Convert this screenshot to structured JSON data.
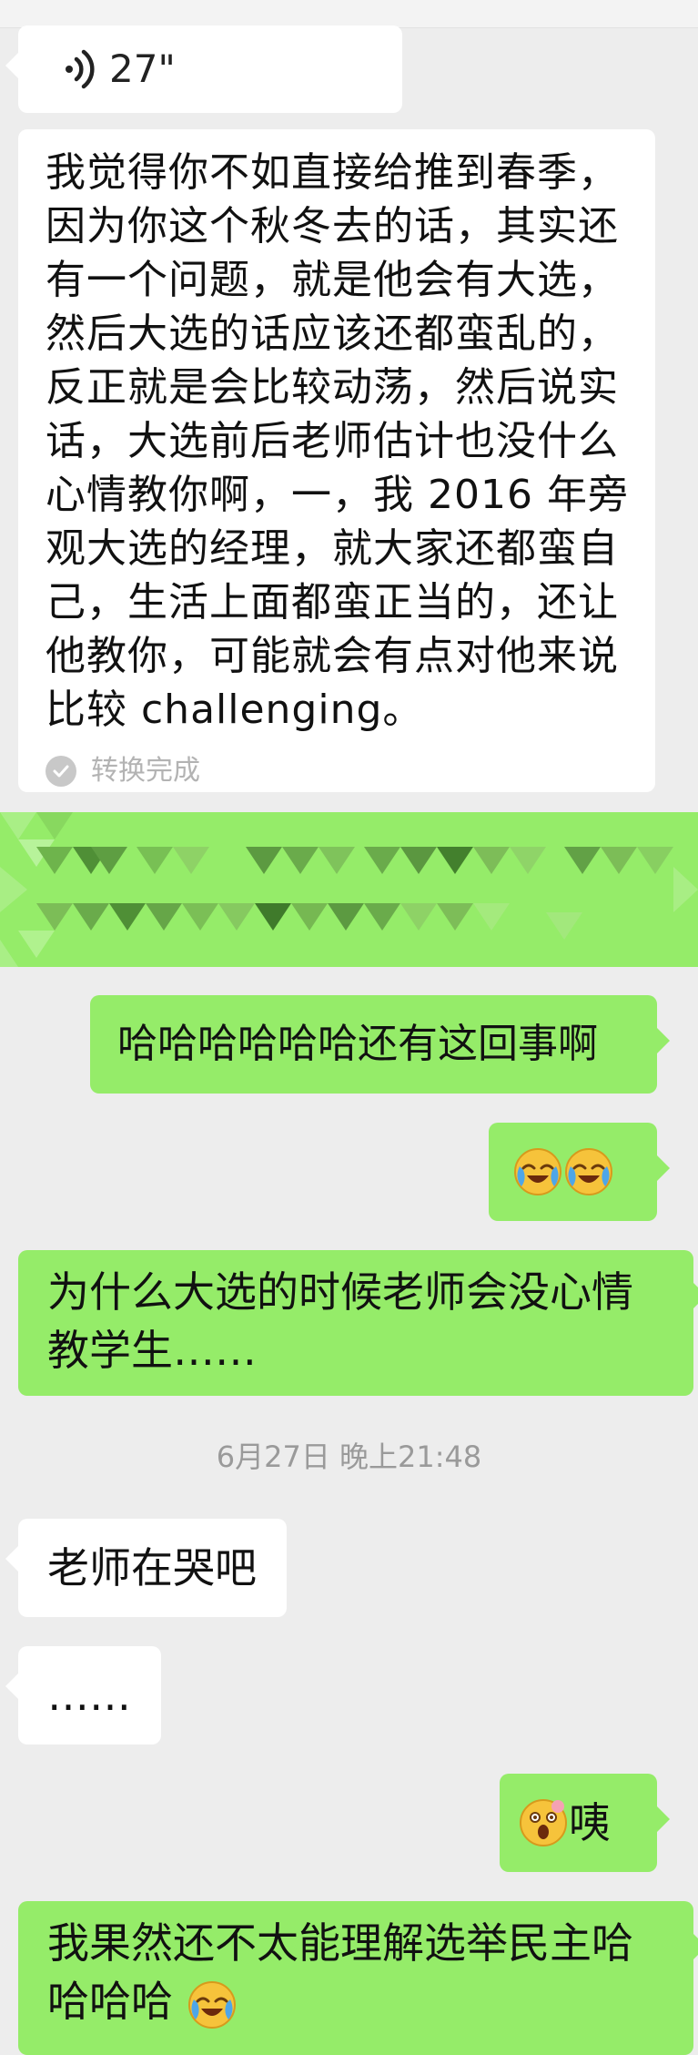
{
  "voice": {
    "duration": "27\""
  },
  "transcript": {
    "text": "我觉得你不如直接给推到春季，因为你这个秋冬去的话，其实还有一个问题，就是他会有大选，然后大选的话应该还都蛮乱的，反正就是会比较动荡，然后说实话，大选前后老师估计也没什么心情教你啊，一，我 2016 年旁观大选的经理，就大家还都蛮自己，生活上面都蛮正当的，还让他教你，可能就会有点对他来说比较 challenging。",
    "status": "转换完成"
  },
  "messages": {
    "m1": "哈哈哈哈哈哈还有这回事啊",
    "m3": "为什么大选的时候老师会没心情教学生……",
    "timestamp": "6月27日 晚上21:48",
    "m4": "老师在哭吧",
    "m5": "……",
    "m6_text": "咦",
    "m7_text": "我果然还不太能理解选举民主哈哈哈哈"
  },
  "icons": {
    "voice": "voice-wave-icon",
    "check": "check-circle-icon",
    "laugh_cry": "loudly-crying-laughing-emoji",
    "shocked": "astonished-emoji"
  },
  "colors": {
    "incoming": "#ffffff",
    "outgoing": "#95ec69",
    "background": "#ededed"
  }
}
